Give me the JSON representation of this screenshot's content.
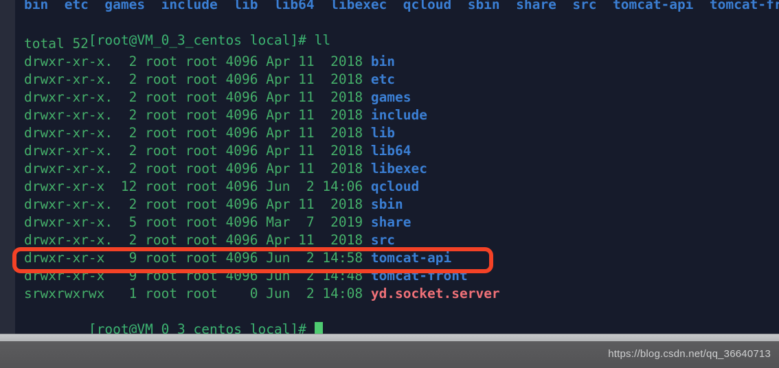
{
  "terminal": {
    "completion_line": "bin  etc  games  include  lib  lib64  libexec  qcloud  sbin  share  src  tomcat-api  tomcat-front",
    "command_line": {
      "prompt": "[root@VM_0_3_centos local]# ",
      "command": "ll"
    },
    "total_line": "total 52",
    "rows": [
      {
        "meta": "drwxr-xr-x.  2 root root 4096 Apr 11  2018 ",
        "name": "bin",
        "name_color": "dir"
      },
      {
        "meta": "drwxr-xr-x.  2 root root 4096 Apr 11  2018 ",
        "name": "etc",
        "name_color": "dir"
      },
      {
        "meta": "drwxr-xr-x.  2 root root 4096 Apr 11  2018 ",
        "name": "games",
        "name_color": "dir"
      },
      {
        "meta": "drwxr-xr-x.  2 root root 4096 Apr 11  2018 ",
        "name": "include",
        "name_color": "dir"
      },
      {
        "meta": "drwxr-xr-x.  2 root root 4096 Apr 11  2018 ",
        "name": "lib",
        "name_color": "dir"
      },
      {
        "meta": "drwxr-xr-x.  2 root root 4096 Apr 11  2018 ",
        "name": "lib64",
        "name_color": "dir"
      },
      {
        "meta": "drwxr-xr-x.  2 root root 4096 Apr 11  2018 ",
        "name": "libexec",
        "name_color": "dir"
      },
      {
        "meta": "drwxr-xr-x  12 root root 4096 Jun  2 14:06 ",
        "name": "qcloud",
        "name_color": "dir"
      },
      {
        "meta": "drwxr-xr-x.  2 root root 4096 Apr 11  2018 ",
        "name": "sbin",
        "name_color": "dir"
      },
      {
        "meta": "drwxr-xr-x.  5 root root 4096 Mar  7  2019 ",
        "name": "share",
        "name_color": "dir"
      },
      {
        "meta": "drwxr-xr-x.  2 root root 4096 Apr 11  2018 ",
        "name": "src",
        "name_color": "dir"
      },
      {
        "meta": "drwxr-xr-x   9 root root 4096 Jun  2 14:58 ",
        "name": "tomcat-api",
        "name_color": "dir"
      },
      {
        "meta": "drwxr-xr-x   9 root root 4096 Jun  2 14:48 ",
        "name": "tomcat-front",
        "name_color": "dir"
      },
      {
        "meta": "srwxrwxrwx   1 root root    0 Jun  2 14:08 ",
        "name": "yd.socket.server",
        "name_color": "sock"
      }
    ],
    "final_prompt": "[root@VM_0_3_centos local]# "
  },
  "annotation": {
    "highlight_target": "tomcat-api",
    "color": "#f44226"
  },
  "watermark": {
    "text": "https://blog.csdn.net/qq_36640713"
  },
  "colors": {
    "terminal_bg": "#161b2b",
    "gutter_bg": "#282c3a",
    "green": "#45b06a",
    "dir_blue": "#3b7fd4",
    "socket_pink": "#f07178",
    "accent_red": "#f44226",
    "bottom_bar": "#565658"
  }
}
